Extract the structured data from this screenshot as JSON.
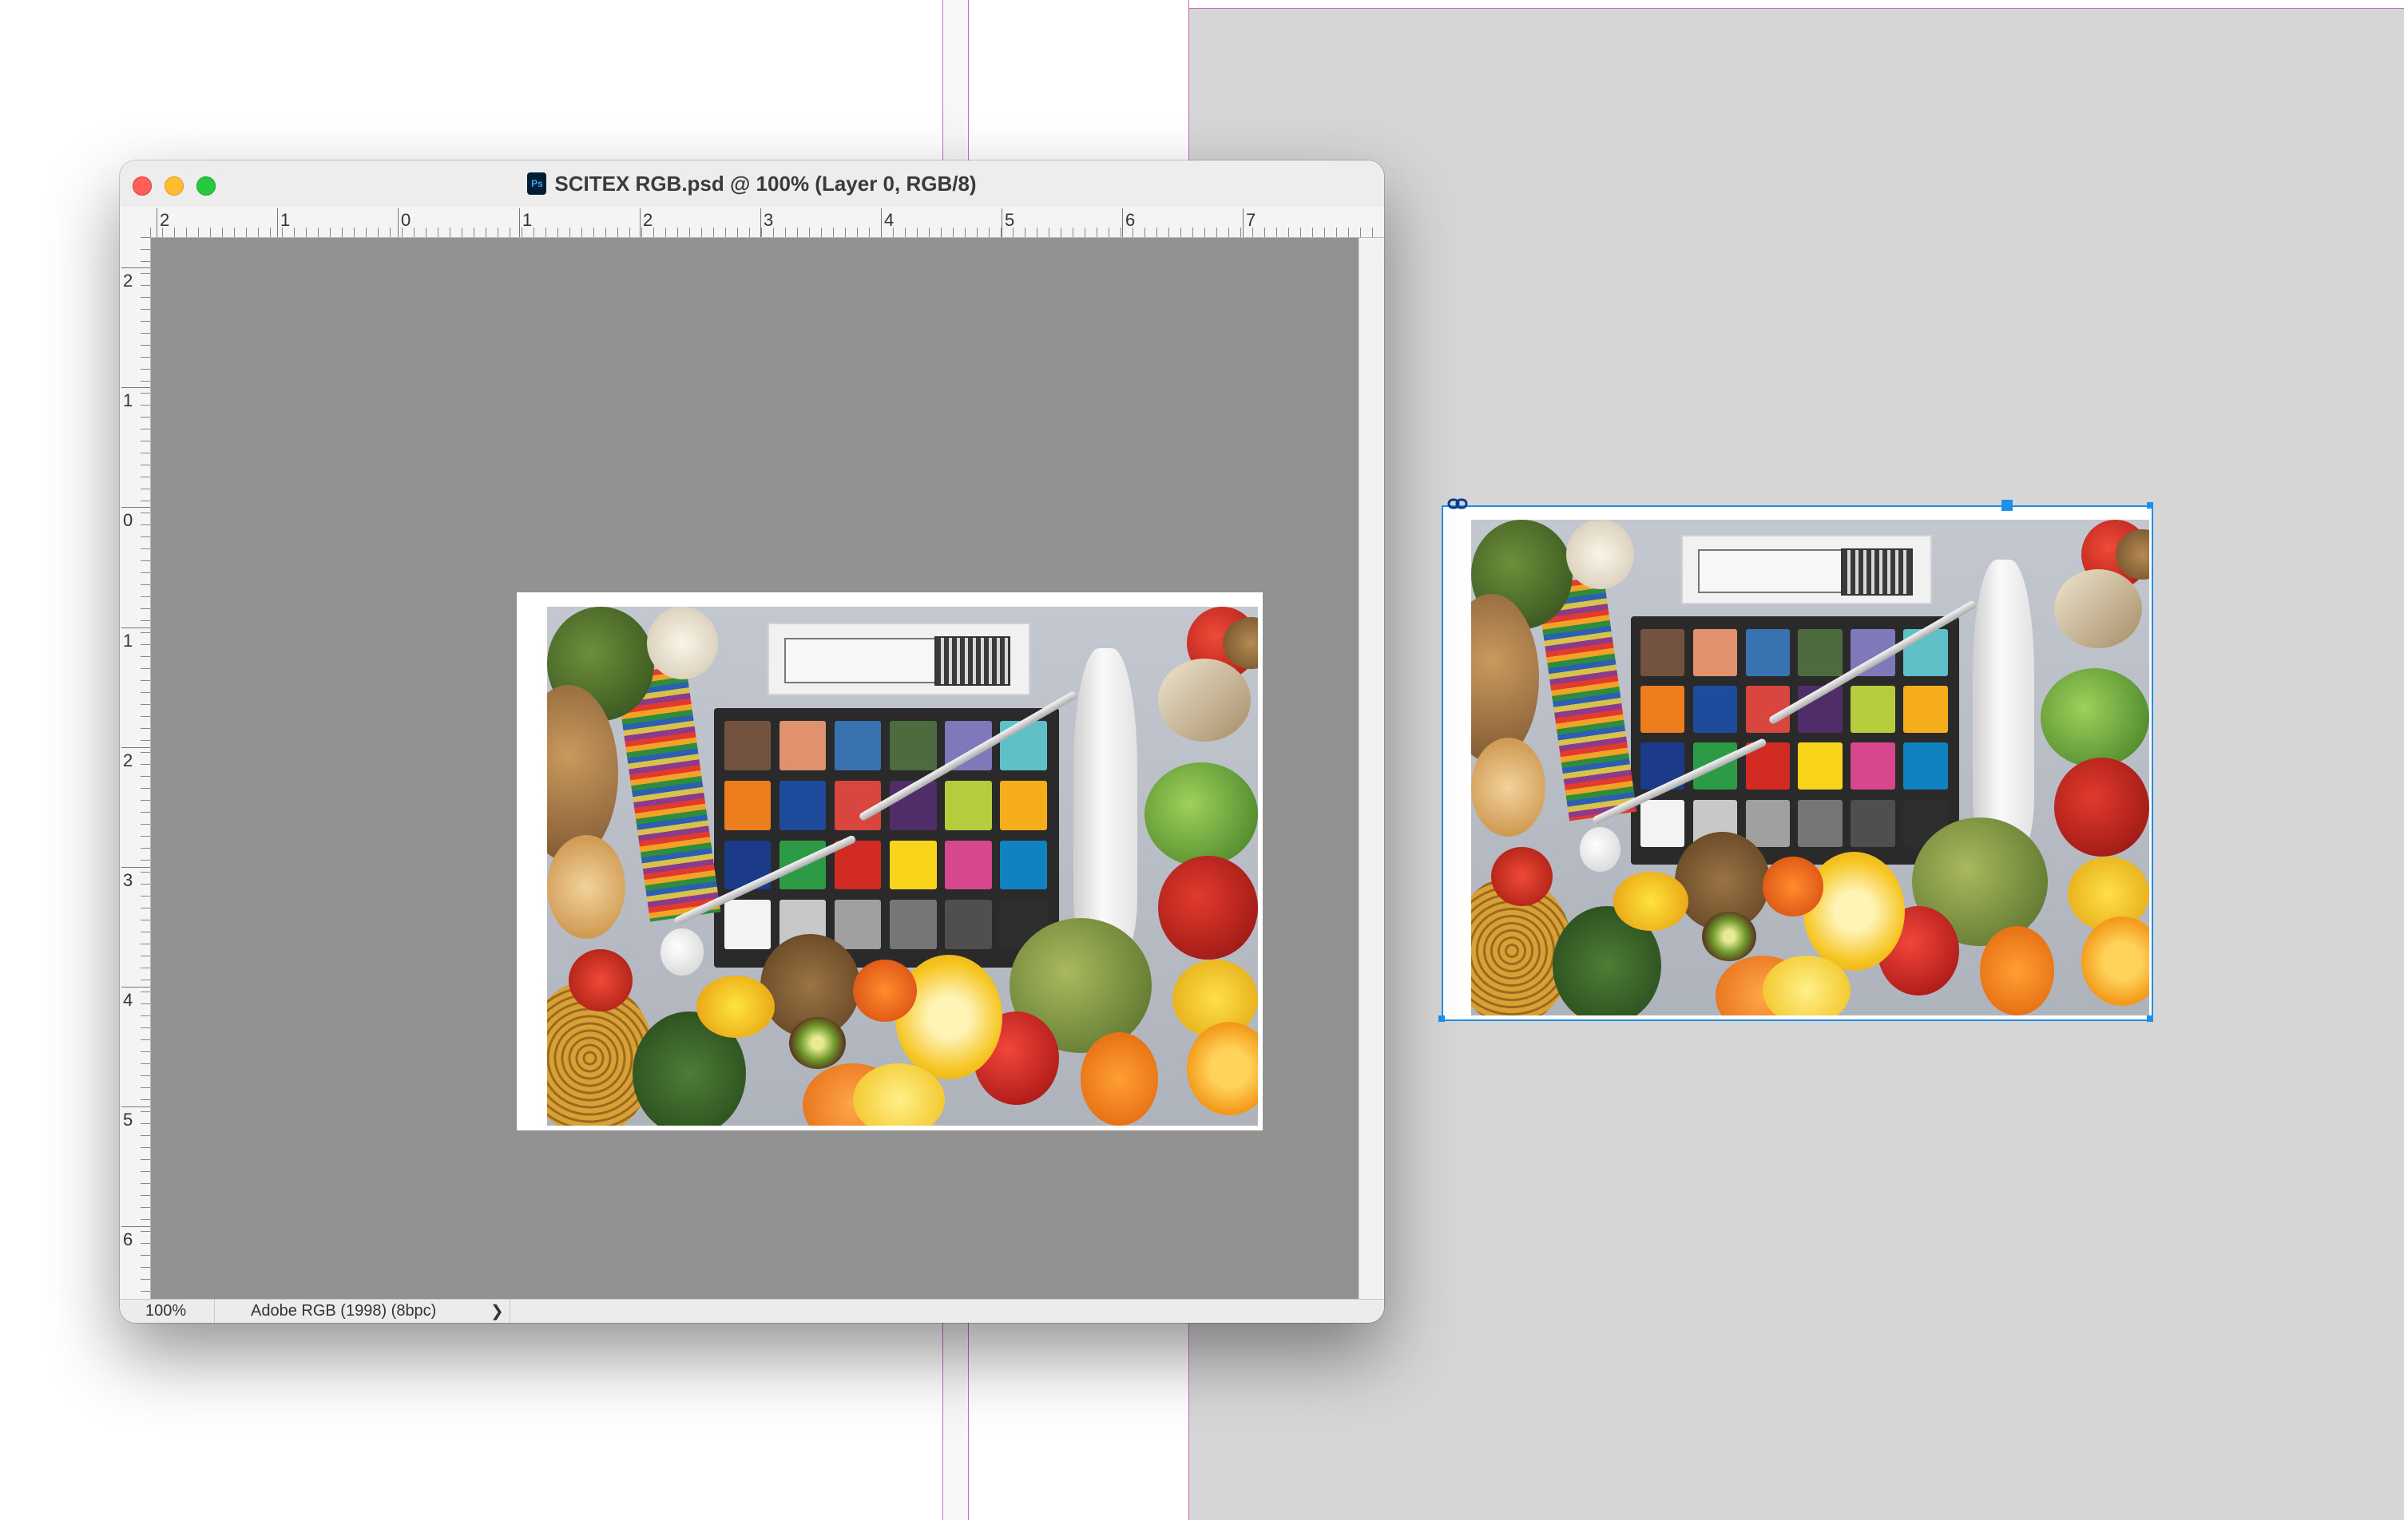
{
  "window": {
    "title": "SCITEX RGB.psd @ 100% (Layer 0, RGB/8)",
    "app_badge": "Ps"
  },
  "rulers": {
    "horizontal": [
      "2",
      "1",
      "0",
      "1",
      "2",
      "3",
      "4",
      "5",
      "6",
      "7"
    ],
    "vertical": [
      "2",
      "1",
      "0",
      "1",
      "2",
      "3",
      "4",
      "5",
      "6"
    ]
  },
  "status_bar": {
    "zoom": "100%",
    "color_profile": "Adobe RGB (1998) (8bpc)",
    "arrow": "❯"
  },
  "colors": {
    "canvas": "#929292",
    "page_area": "#d6d6d6",
    "guide": "#c66ac6",
    "selection": "#1f8fea"
  },
  "color_checker": [
    "#73523f",
    "#e0916d",
    "#3872b1",
    "#4d6b3e",
    "#7f79bc",
    "#5fc0c8",
    "#ec7e1e",
    "#1f4b9c",
    "#d94640",
    "#4f2d68",
    "#b6cc3c",
    "#f5ad1c",
    "#1b3b8a",
    "#2d9a46",
    "#d12b24",
    "#f8d41a",
    "#d7478d",
    "#0f82bf",
    "#f3f3f3",
    "#c8c8c8",
    "#a0a0a0",
    "#767676",
    "#4f4f4f",
    "#2e2e2e"
  ]
}
